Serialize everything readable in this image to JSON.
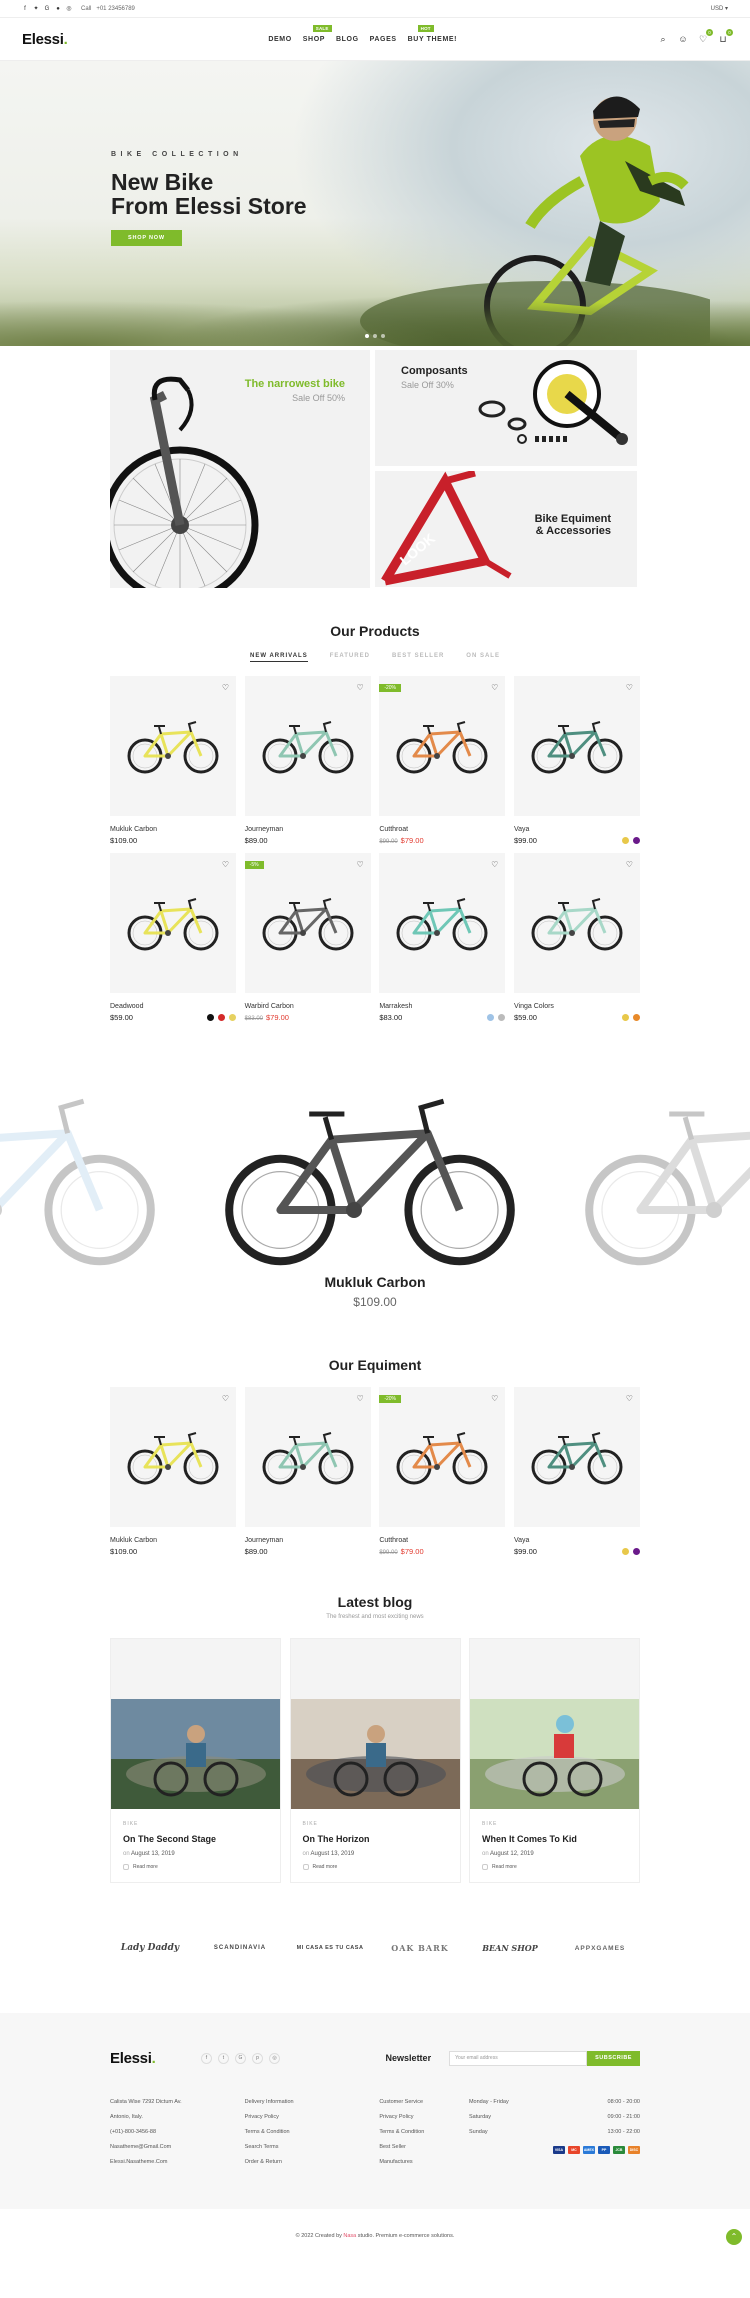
{
  "topbar": {
    "call_label": "Call",
    "phone": "+01 23456789",
    "currency": "USD"
  },
  "header": {
    "logo": "Elessi",
    "nav": [
      {
        "label": "DEMO",
        "badge": ""
      },
      {
        "label": "SHOP",
        "badge": "SALE"
      },
      {
        "label": "BLOG",
        "badge": ""
      },
      {
        "label": "PAGES",
        "badge": ""
      },
      {
        "label": "BUY THEME!",
        "badge": "HOT"
      }
    ],
    "wishlist_count": "0",
    "cart_count": "0"
  },
  "hero": {
    "subtitle": "BIKE COLLECTION",
    "title_line1": "New Bike",
    "title_line2": "From Elessi Store",
    "button": "SHOP NOW"
  },
  "banners": {
    "b1_title": "The narrowest bike",
    "b1_sub": "Sale Off 50%",
    "b2_title": "Composants",
    "b2_sub": "Sale Off 30%",
    "b3_title_line1": "Bike Equiment",
    "b3_title_line2": "& Accessories"
  },
  "products_section": {
    "title": "Our Products",
    "tabs": [
      "NEW ARRIVALS",
      "FEATURED",
      "BEST SELLER",
      "ON SALE"
    ],
    "items": [
      {
        "name": "Mukluk Carbon",
        "price": "$109.00",
        "old_price": "",
        "sale": "",
        "frame": "#e8e35a",
        "swatches": []
      },
      {
        "name": "Journeyman",
        "price": "$89.00",
        "old_price": "",
        "sale": "",
        "frame": "#8fc6b2",
        "swatches": []
      },
      {
        "name": "Cutthroat",
        "price": "$79.00",
        "old_price": "$99.00",
        "sale": "-20%",
        "frame": "#e38a4a",
        "swatches": []
      },
      {
        "name": "Vaya",
        "price": "$99.00",
        "old_price": "",
        "sale": "",
        "frame": "#4f8f80",
        "swatches": [
          "#e8c84a",
          "#6a1a8a"
        ]
      },
      {
        "name": "Deadwood",
        "price": "$59.00",
        "old_price": "",
        "sale": "",
        "frame": "#e8e35a",
        "swatches": [
          "#111111",
          "#d42a2a",
          "#e6d160"
        ]
      },
      {
        "name": "Warbird Carbon",
        "price": "$79.00",
        "old_price": "$83.00",
        "sale": "-5%",
        "frame": "#666666",
        "swatches": []
      },
      {
        "name": "Marrakesh",
        "price": "$83.00",
        "old_price": "",
        "sale": "",
        "frame": "#6fc7b6",
        "swatches": [
          "#9fc3e6",
          "#bbbbbb"
        ]
      },
      {
        "name": "Vinga Colors",
        "price": "$59.00",
        "old_price": "",
        "sale": "",
        "frame": "#a8d8c8",
        "swatches": [
          "#e8c84a",
          "#e88a2a"
        ]
      }
    ]
  },
  "featured": {
    "name": "Mukluk Carbon",
    "price": "$109.00"
  },
  "equipment_section": {
    "title": "Our Equiment",
    "items": [
      {
        "name": "Mukluk Carbon",
        "price": "$109.00",
        "old_price": "",
        "sale": "",
        "frame": "#e8e35a",
        "swatches": []
      },
      {
        "name": "Journeyman",
        "price": "$89.00",
        "old_price": "",
        "sale": "",
        "frame": "#8fc6b2",
        "swatches": []
      },
      {
        "name": "Cutthroat",
        "price": "$79.00",
        "old_price": "$99.00",
        "sale": "-20%",
        "frame": "#e38a4a",
        "swatches": []
      },
      {
        "name": "Vaya",
        "price": "$99.00",
        "old_price": "",
        "sale": "",
        "frame": "#4f8f80",
        "swatches": [
          "#e8c84a",
          "#6a1a8a"
        ]
      }
    ]
  },
  "blog": {
    "title": "Latest blog",
    "subtitle": "The freshest and most exciting news",
    "posts": [
      {
        "category": "BIKE",
        "title": "On The Second Stage",
        "date_prefix": "on",
        "date": "August 13, 2019",
        "read": "Read more"
      },
      {
        "category": "BIKE",
        "title": "On The Horizon",
        "date_prefix": "on",
        "date": "August 13, 2019",
        "read": "Read more"
      },
      {
        "category": "BIKE",
        "title": "When It Comes To Kid",
        "date_prefix": "on",
        "date": "August 12, 2019",
        "read": "Read more"
      }
    ]
  },
  "brands": [
    "Lady Daddy",
    "SCANDINAVIA",
    "MI CASA ES TU CASA",
    "OAK BARK",
    "BEAN SHOP",
    "APPXGAMES"
  ],
  "footer": {
    "logo": "Elessi",
    "newsletter_title": "Newsletter",
    "newsletter_placeholder": "Your email address",
    "subscribe": "SUBSCRIBE",
    "contact": [
      "Calista Wise 7292 Dictum Av.",
      "Antonio, Italy.",
      "(+01)-800-3456-88",
      "Nasatheme@Gmail.Com",
      "Elessi.Nasatheme.Com"
    ],
    "links1": [
      "Delivery Information",
      "Privacy Policy",
      "Terms & Condition",
      "Search Terms",
      "Order & Return"
    ],
    "links2": [
      "Customer Service",
      "Privacy Policy",
      "Terms & Condition",
      "Best Seller",
      "Manufactures"
    ],
    "hours": [
      {
        "day": "Monday - Friday",
        "time": "08:00 - 20:00"
      },
      {
        "day": "Saturday",
        "time": "09:00 - 21:00"
      },
      {
        "day": "Sunday",
        "time": "13:00 - 22:00"
      }
    ],
    "payments": [
      "VISA",
      "MC",
      "AMEX",
      "PP",
      "JCB",
      "DISC"
    ],
    "copyright_prefix": "© 2022 Created by",
    "copyright_brand": "Nasa",
    "copyright_suffix": "studio. Premium e-commerce solutions."
  }
}
